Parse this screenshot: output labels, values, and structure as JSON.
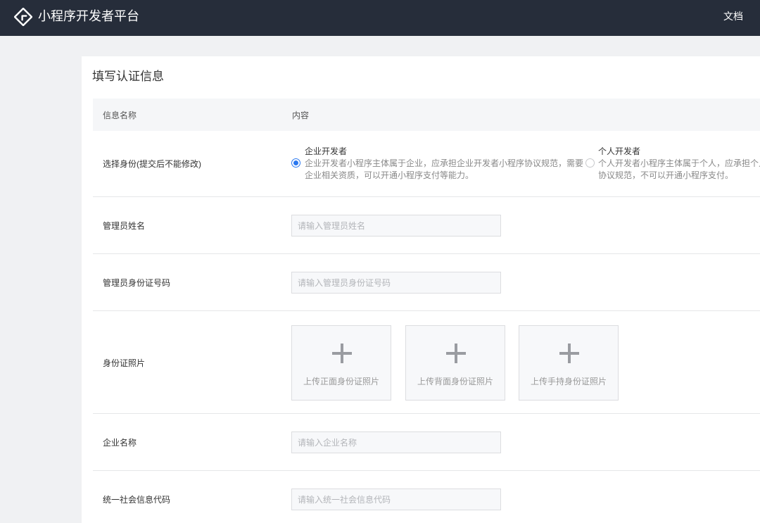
{
  "header": {
    "brand": "小程序开发者平台",
    "doc_link": "文档"
  },
  "form": {
    "title": "填写认证信息",
    "columns": {
      "name": "信息名称",
      "content": "内容"
    },
    "identity": {
      "label": "选择身份(提交后不能修改)",
      "options": [
        {
          "title": "企业开发者",
          "desc_line1": "企业开发者小程序主体属于企业，应承担企业开发者小程序协议规范，需要",
          "desc_line2": "企业相关资质，可以开通小程序支付等能力。",
          "checked": true
        },
        {
          "title": "个人开发者",
          "desc_line1": "个人开发者小程序主体属于个人，应承担个人",
          "desc_line2": "协议规范，不可以开通小程序支付。",
          "checked": false
        }
      ]
    },
    "admin_name": {
      "label": "管理员姓名",
      "placeholder": "请输入管理员姓名",
      "value": ""
    },
    "admin_id": {
      "label": "管理员身份证号码",
      "placeholder": "请输入管理员身份证号码",
      "value": ""
    },
    "id_photos": {
      "label": "身份证照片",
      "uploads": [
        {
          "label": "上传正面身份证照片"
        },
        {
          "label": "上传背面身份证照片"
        },
        {
          "label": "上传手持身份证照片"
        }
      ]
    },
    "company_name": {
      "label": "企业名称",
      "placeholder": "请输入企业名称",
      "value": ""
    },
    "credit_code": {
      "label": "统一社会信息代码",
      "placeholder": "请输入统一社会信息代码",
      "value": ""
    }
  },
  "colors": {
    "topbar": "#262d3a",
    "accent": "#2a78f0",
    "page_bg": "#f0f1f3"
  }
}
